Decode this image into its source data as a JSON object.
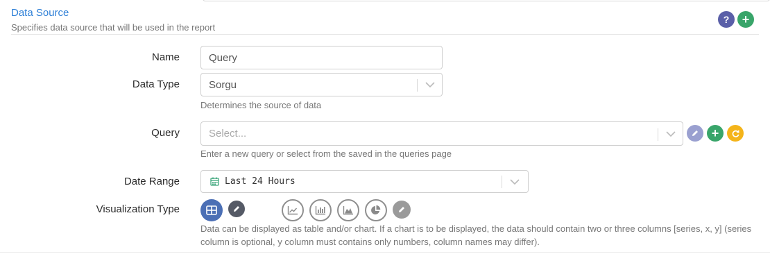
{
  "section": {
    "title": "Data Source",
    "subtitle": "Specifies data source that will be used in the report",
    "help_icon": "question-icon",
    "add_icon": "plus-icon"
  },
  "fields": {
    "name": {
      "label": "Name",
      "value": "Query"
    },
    "data_type": {
      "label": "Data Type",
      "value": "Sorgu",
      "help": "Determines the source of data"
    },
    "query": {
      "label": "Query",
      "placeholder": "Select...",
      "help": "Enter a new query or select from the saved in the queries page"
    },
    "date_range": {
      "label": "Date Range",
      "value": "Last 24 Hours",
      "icon": "calendar-icon"
    },
    "visualization": {
      "label": "Visualization Type",
      "help": "Data can be displayed as table and/or chart. If a chart is to be displayed, the data should contain two or three columns [series, x, y] (series column is optional, y column must contains only numbers, column names may differ).",
      "options": [
        "table-icon",
        "edit-icon",
        "line-chart-icon",
        "bar-chart-icon",
        "area-chart-icon",
        "pie-chart-icon",
        "edit-icon"
      ],
      "selected": "table-icon"
    }
  },
  "colors": {
    "title": "#2f80d7",
    "help_button": "#5a5fa8",
    "add_button": "#39a56a",
    "edit_button": "#9aa0d0",
    "refresh_button": "#f4b41a",
    "viz_selected": "#4b6fb5"
  }
}
